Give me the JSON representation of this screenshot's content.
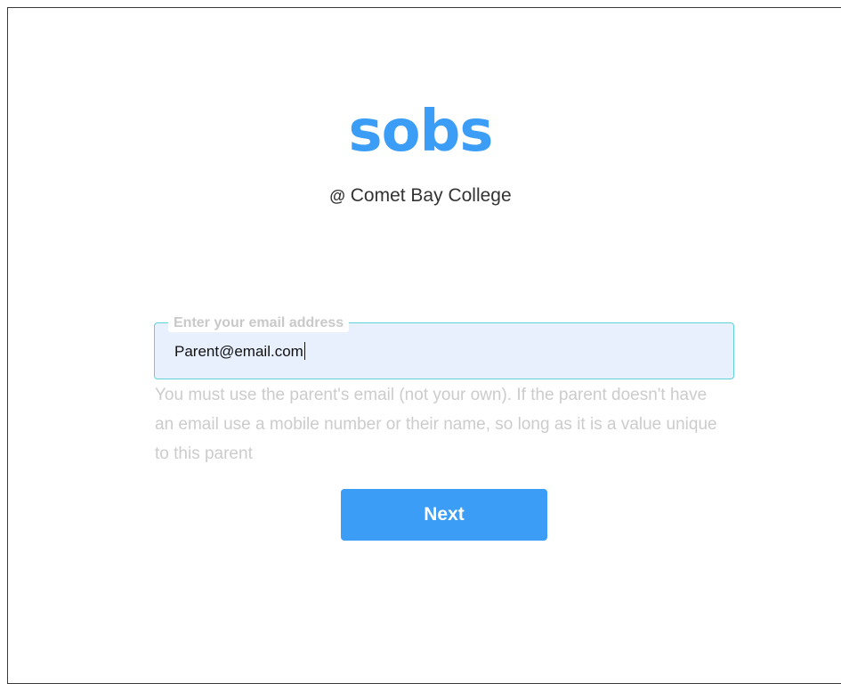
{
  "brand": {
    "logo_text": "sobs",
    "logo_color": "#3b9df6",
    "school_prefix": "@",
    "school_name": "Comet Bay College"
  },
  "email_field": {
    "label": "Enter your email address",
    "value": "Parent@email.com"
  },
  "help_text": "You must use the parent's email (not your own). If the parent doesn't have an email use a mobile number or their name, so long as it is a value unique to this parent",
  "actions": {
    "next_label": "Next",
    "next_color": "#3b9df6"
  },
  "colors": {
    "field_border": "#5fd3d6",
    "field_background": "#e8f0fe",
    "help_text": "#cccccc"
  }
}
